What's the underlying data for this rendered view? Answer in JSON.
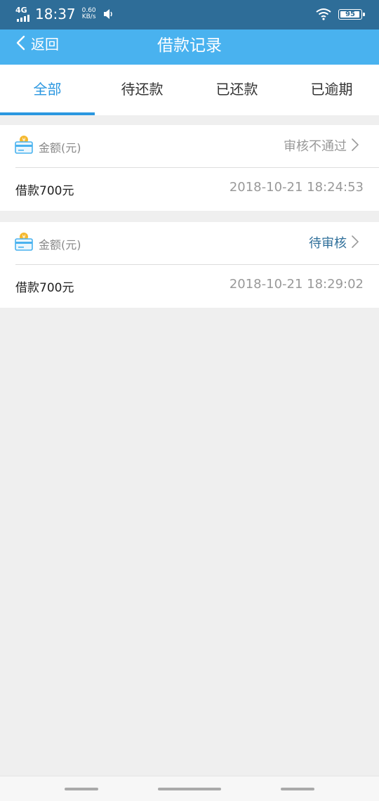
{
  "status_bar": {
    "network": "4G",
    "time": "18:37",
    "speed_value": "0.60",
    "speed_unit": "KB/s",
    "battery": "95"
  },
  "navbar": {
    "back_label": "返回",
    "title": "借款记录"
  },
  "tabs": [
    {
      "label": "全部",
      "active": true
    },
    {
      "label": "待还款",
      "active": false
    },
    {
      "label": "已还款",
      "active": false
    },
    {
      "label": "已逾期",
      "active": false
    }
  ],
  "records": [
    {
      "amount_label": "金额(元)",
      "status": "审核不通过",
      "status_color": "#999999",
      "name": "借款700元",
      "datetime": "2018-10-21 18:24:53"
    },
    {
      "amount_label": "金额(元)",
      "status": "待审核",
      "status_color": "#2f6f9a",
      "name": "借款700元",
      "datetime": "2018-10-21 18:29:02"
    }
  ],
  "colors": {
    "status_bar": "#2e6d98",
    "nav_bar": "#49b2ef",
    "tab_active": "#2a97e0",
    "background": "#efefef"
  }
}
